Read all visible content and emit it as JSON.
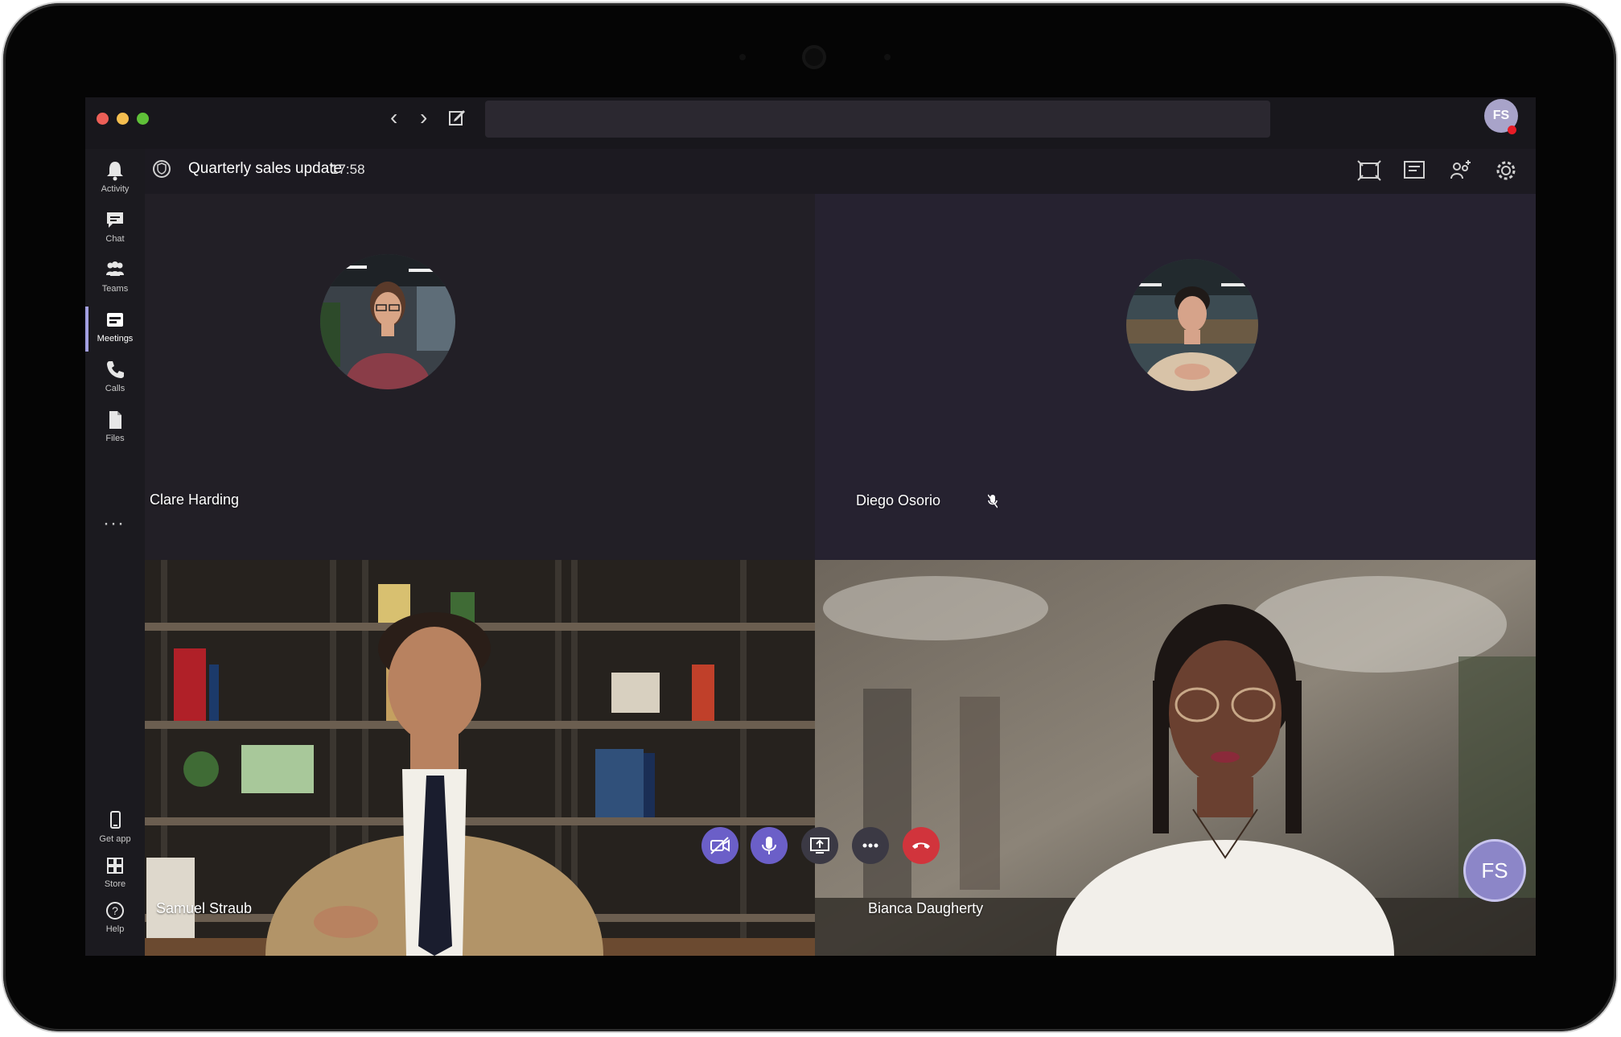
{
  "window": {
    "nav_back": "‹",
    "nav_forward": "›",
    "user_initials": "FS"
  },
  "rail": {
    "items": [
      {
        "label": "Activity",
        "icon": "bell-icon"
      },
      {
        "label": "Chat",
        "icon": "chat-icon"
      },
      {
        "label": "Teams",
        "icon": "teams-icon"
      },
      {
        "label": "Meetings",
        "icon": "calendar-icon"
      },
      {
        "label": "Calls",
        "icon": "phone-icon"
      },
      {
        "label": "Files",
        "icon": "file-icon"
      }
    ],
    "more": "···",
    "bottom_items": [
      {
        "label": "Get app",
        "icon": "phone-device-icon"
      },
      {
        "label": "Store",
        "icon": "store-icon"
      },
      {
        "label": "Help",
        "icon": "help-icon"
      }
    ],
    "active_index": 3
  },
  "meeting": {
    "title": "Quarterly sales update",
    "timer": "17:58"
  },
  "participants": {
    "clare": "Clare Harding",
    "diego": "Diego Osorio",
    "samuel": "Samuel Straub",
    "bianca": "Bianca Daugherty"
  },
  "self_view": {
    "initials": "FS"
  },
  "colors": {
    "accent": "#6b5fc8",
    "hangup": "#d1343c",
    "background": "#1c1a21"
  }
}
